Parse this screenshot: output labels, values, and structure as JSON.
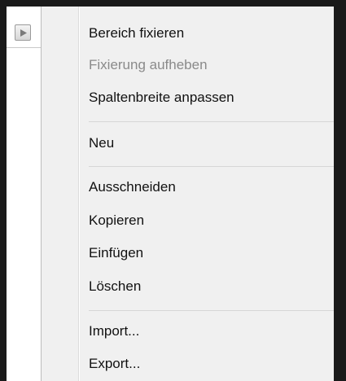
{
  "context_menu": {
    "items": [
      {
        "label": "Bereich fixieren",
        "enabled": true
      },
      {
        "label": "Fixierung aufheben",
        "enabled": false
      },
      {
        "label": "Spaltenbreite anpassen",
        "enabled": true
      },
      {
        "label": "Neu",
        "enabled": true
      },
      {
        "label": "Ausschneiden",
        "enabled": true
      },
      {
        "label": "Kopieren",
        "enabled": true
      },
      {
        "label": "Einfügen",
        "enabled": true
      },
      {
        "label": "Löschen",
        "enabled": true
      },
      {
        "label": "Import...",
        "enabled": true
      },
      {
        "label": "Export...",
        "enabled": true
      }
    ]
  },
  "left_panel": {
    "expand_icon": "triangle-right-icon"
  }
}
